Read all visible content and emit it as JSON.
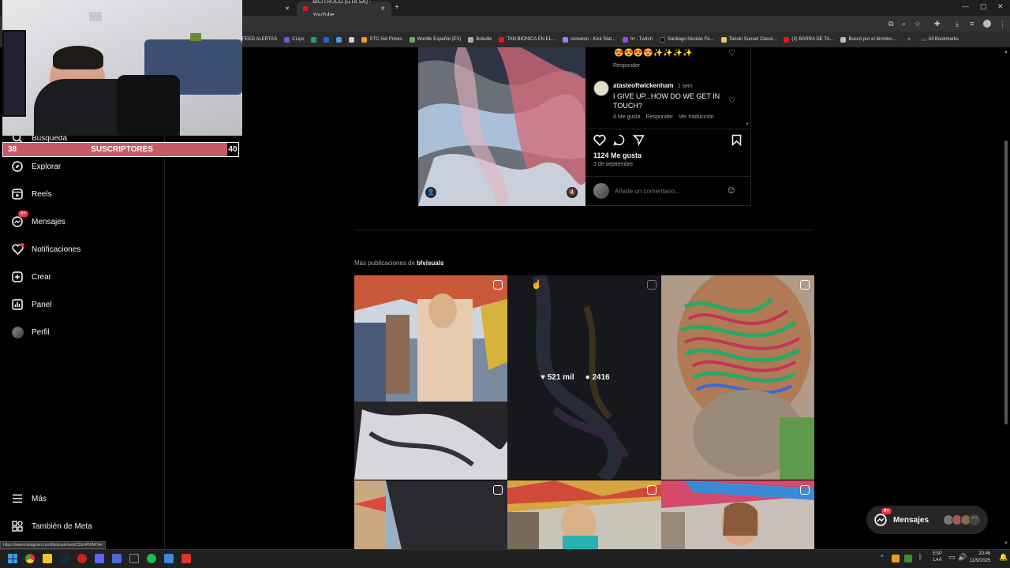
{
  "browser": {
    "tabs": [
      {
        "label": ""
      },
      {
        "label": "BICITRUCO (GTA SA) - YouTube"
      }
    ],
    "new_tab": "+",
    "bookmarks": [
      {
        "label": "FEED ALERTAS",
        "color": "#888"
      },
      {
        "label": "CLips",
        "color": "#6b5bd6"
      },
      {
        "label": "",
        "color": "#1aa37a"
      },
      {
        "label": "",
        "color": "#2266dd"
      },
      {
        "label": "",
        "color": "#3aa0e6"
      },
      {
        "label": "",
        "color": "#ccc"
      },
      {
        "label": "STC Set Prices",
        "color": "#e9a019"
      },
      {
        "label": "Wordle Español (ES)",
        "color": "#6aaa64"
      },
      {
        "label": "Boludle",
        "color": "#aaa"
      },
      {
        "label": "TAN BIONICA EN EL...",
        "color": "#e11"
      },
      {
        "label": "cionaron - Kick Stat...",
        "color": "#8a8aff"
      },
      {
        "label": "trr - Twitch",
        "color": "#9146ff"
      },
      {
        "label": "Santiago Nicolas Fe...",
        "color": "#111"
      },
      {
        "label": "Tanuki Sunset Classi...",
        "color": "#e9c46a"
      },
      {
        "label": "(2) BARRA DE TA...",
        "color": "#e11"
      },
      {
        "label": "Buscó por el término...",
        "color": "#bbb"
      }
    ],
    "all_bookmarks": "All Bookmarks",
    "status_url": "https://www.instagram.com/blvisuals/reel/C3JmPVIMO4r/"
  },
  "overlay": {
    "subs_left": "38",
    "subs_label": "SUSCRIPTORES",
    "subs_right": "40"
  },
  "sidebar": {
    "items": [
      {
        "label": "Búsqueda",
        "icon": "search-icon"
      },
      {
        "label": "Explorar",
        "icon": "compass-icon"
      },
      {
        "label": "Reels",
        "icon": "reels-icon"
      },
      {
        "label": "Mensajes",
        "icon": "messenger-icon",
        "badge": "9+"
      },
      {
        "label": "Notificaciones",
        "icon": "heart-icon"
      },
      {
        "label": "Crear",
        "icon": "plus-icon"
      },
      {
        "label": "Panel",
        "icon": "chart-icon"
      },
      {
        "label": "Perfil",
        "icon": "avatar-icon"
      }
    ],
    "bottom": [
      {
        "label": "Más",
        "icon": "menu-icon"
      },
      {
        "label": "También de Meta",
        "icon": "meta-icon"
      }
    ]
  },
  "post": {
    "comment1": {
      "emojis": "😍😍😍😍✨✨✨✨",
      "reply": "Responder"
    },
    "comment2": {
      "user": "atasteoftwickenham",
      "time": "1 sem",
      "text": "I GIVE UP...HOW DO WE GET IN TOUCH?",
      "likes": "4 Me gusta",
      "reply": "Responder",
      "translate": "Ver traducción"
    },
    "likes": "1124 Me gusta",
    "date": "3 de septiembre",
    "comment_placeholder": "Añade un comentario..."
  },
  "more": {
    "prefix": "Más publicaciones de ",
    "user": "blvisuals",
    "hover_likes": "521 mil",
    "hover_comments": "2416"
  },
  "messages_pill": {
    "label": "Mensajes",
    "badge": "9+"
  },
  "taskbar": {
    "lang_top": "ESP",
    "lang_bottom": "LAA",
    "time": "20:46",
    "date": "11/9/2025"
  }
}
